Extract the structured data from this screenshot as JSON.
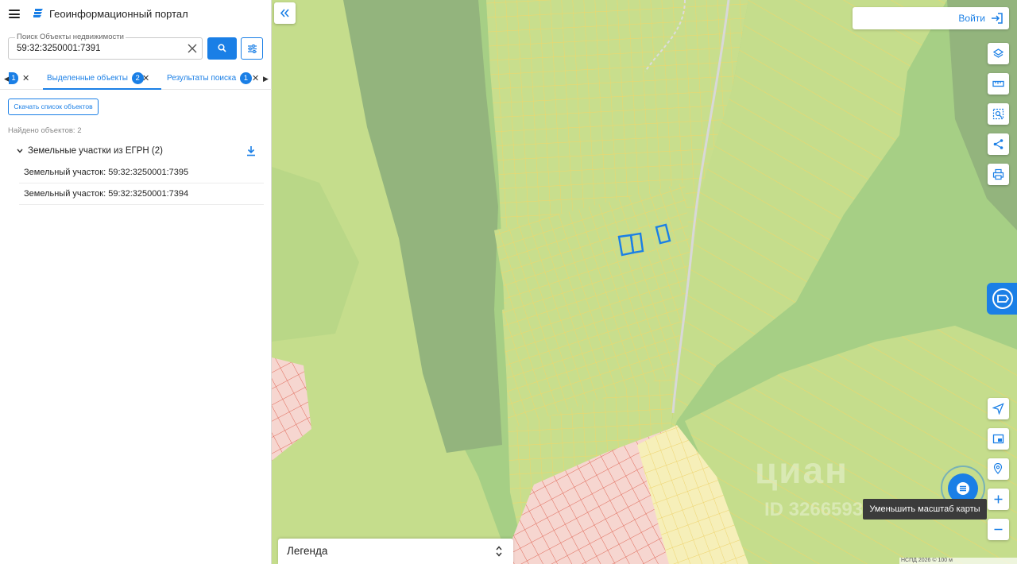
{
  "header": {
    "title": "Геоинформационный портал"
  },
  "search": {
    "label": "Поиск Объекты недвижимости",
    "value": "59:32:3250001:7391"
  },
  "tabs": {
    "hidden_badge": "1",
    "items": [
      {
        "label": "Выделенные объекты",
        "badge": "2",
        "active": true
      },
      {
        "label": "Результаты поиска",
        "badge": "1",
        "active": false
      }
    ]
  },
  "results": {
    "download_list_label": "Скачать список объектов",
    "found_text": "Найдено объектов: 2",
    "group_title": "Земельные участки из ЕГРН (2)",
    "items": [
      "Земельный участок: 59:32:3250001:7395",
      "Земельный участок: 59:32:3250001:7394"
    ]
  },
  "map": {
    "login_label": "Войти",
    "legend_label": "Легенда",
    "tooltip": "Уменьшить масштаб карты",
    "watermark": "циан",
    "watermark_id": "ID 326659367",
    "copyright": "НСПД 2026 ©        100 м",
    "tools": [
      "layers-icon",
      "ruler-icon",
      "select-area-icon",
      "share-icon",
      "print-icon"
    ],
    "nav_tools": [
      "locate-icon",
      "minimap-icon",
      "geo-search-icon",
      "zoom-in-icon",
      "zoom-out-icon"
    ]
  },
  "colors": {
    "accent": "#1a7fe6",
    "forest": "#a6cf85",
    "dark_forest": "#93b47d",
    "field": "#c5dd8c",
    "parcel_line": "#f5d96a",
    "residential": "#f5d5d0",
    "residential_line": "#e06b5b",
    "selected": "#1a7fe6"
  }
}
